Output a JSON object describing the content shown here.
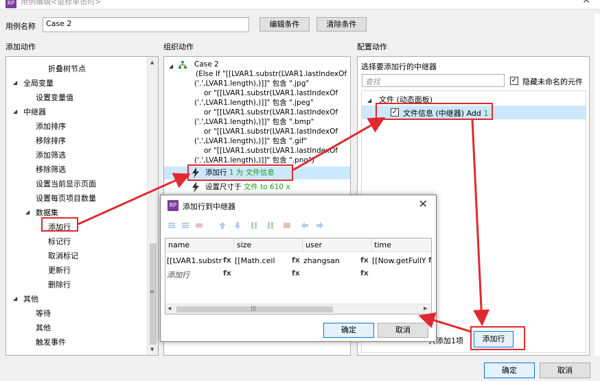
{
  "window": {
    "title": "用例编辑<鼠标单击时>",
    "logo": "RP",
    "close": "✕"
  },
  "case_name": {
    "label": "用例名称",
    "value": "Case 2",
    "edit_btn": "编辑条件",
    "clear_btn": "清除条件"
  },
  "left": {
    "header": "添加动作",
    "items": [
      {
        "text": "折叠树节点"
      },
      {
        "text": "全局变量"
      },
      {
        "text": "设置变量值"
      },
      {
        "text": "中继器"
      },
      {
        "text": "添加排序"
      },
      {
        "text": "移除排序"
      },
      {
        "text": "添加筛选"
      },
      {
        "text": "移除筛选"
      },
      {
        "text": "设置当前显示页面"
      },
      {
        "text": "设置每页项目数量"
      },
      {
        "text": "数据集"
      },
      {
        "text": "添加行"
      },
      {
        "text": "标记行"
      },
      {
        "text": "取消标记"
      },
      {
        "text": "更新行"
      },
      {
        "text": "删除行"
      },
      {
        "text": "其他"
      },
      {
        "text": "等待"
      },
      {
        "text": "其他"
      },
      {
        "text": "触发事件"
      }
    ]
  },
  "middle": {
    "header": "组织动作",
    "case_title": "Case 2",
    "lines": [
      "(Else If \"[[LVAR1.substr(LVAR1.lastIndexOf",
      "('.',LVAR1.length),)]]\" 包含 \".jpg\"",
      "or \"[[LVAR1.substr(LVAR1.lastIndexOf",
      "('.',LVAR1.length),)]]\" 包含 \".jpeg\"",
      "or \"[[LVAR1.substr(LVAR1.lastIndexOf",
      "('.',LVAR1.length),)]]\" 包含 \".bmp\"",
      "or \"[[LVAR1.substr(LVAR1.lastIndexOf",
      "('.',LVAR1.length),)]]\" 包含 \".gif\"",
      "or \"[[LVAR1.substr(LVAR1.lastIndexOf",
      "('.',LVAR1.length),)]]\" 包含 \".png\")"
    ],
    "action1_prefix": "添加行 ",
    "action1_green": "1 为 文件信息",
    "action2_prefix": "设置尺寸于 ",
    "action2_green": "文件 to 610 x"
  },
  "right": {
    "header": "配置动作",
    "sub_header": "选择要添加行的中继器",
    "search_placeholder": "查找",
    "hide_unnamed": "隐藏未命名的元件",
    "tree_parent": "文件 (动态面板)",
    "tree_child_prefix": "文件信息 (中继器) Add ",
    "tree_child_green": "1",
    "footer_text": "共添加1项",
    "add_row_btn": "添加行"
  },
  "dialog": {
    "title": "添加行到中继器",
    "logo": "RP",
    "close": "✕",
    "columns": [
      "name",
      "size",
      "user",
      "time"
    ],
    "row1": [
      "[[LVAR1.substr",
      "[[Math.ceil",
      "zhangsan",
      "[[Now.getFullY"
    ],
    "row2_first": "添加行",
    "fx": "fx",
    "scroll_grip": "|||",
    "ok": "确定",
    "cancel": "取消"
  },
  "footer": {
    "ok": "确定",
    "cancel": "取消"
  },
  "colors": {
    "highlight": "#cce8ff",
    "red": "#e0282e",
    "green": "#1b9a1b",
    "accent": "#0078d7"
  }
}
